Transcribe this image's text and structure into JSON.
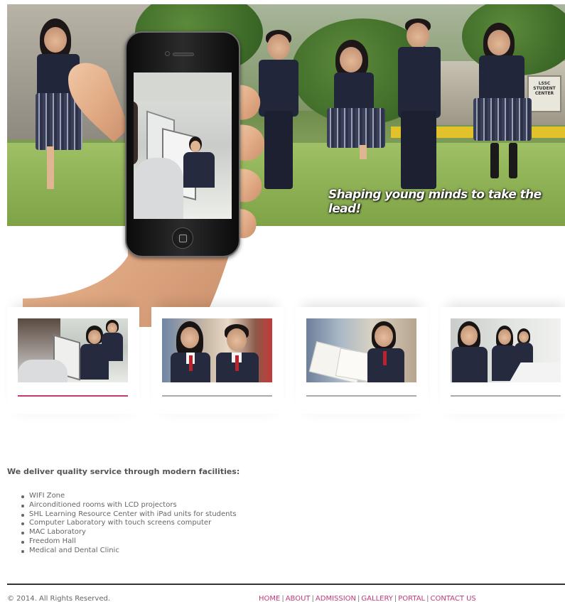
{
  "hero": {
    "slogan": "Shaping young minds to take the lead!",
    "sign_text": "LSSC STUDENT CENTER"
  },
  "thumbnails": [
    {
      "name": "computer-laboratory",
      "active": true
    },
    {
      "name": "students-library",
      "active": false
    },
    {
      "name": "student-reading",
      "active": false
    },
    {
      "name": "mac-laboratory",
      "active": false
    }
  ],
  "colors": {
    "accent": "#c0397a",
    "inactive_bar": "#aaaaaa",
    "footer_rule": "#333333"
  },
  "content": {
    "heading": "We deliver quality service through modern facilities:",
    "facilities": [
      "WIFI Zone",
      "Airconditioned rooms with LCD projectors",
      "SHL Learning Resource Center with iPad units for students",
      "Computer Laboratory with touch screens computer",
      "MAC Laboratory",
      "Freedom Hall",
      "Medical and Dental Clinic"
    ]
  },
  "footer": {
    "copyright": "© 2014. All Rights Reserved.",
    "nav": [
      "HOME",
      "ABOUT",
      "ADMISSION",
      "GALLERY",
      "PORTAL",
      "CONTACT US"
    ],
    "separator": "|"
  }
}
